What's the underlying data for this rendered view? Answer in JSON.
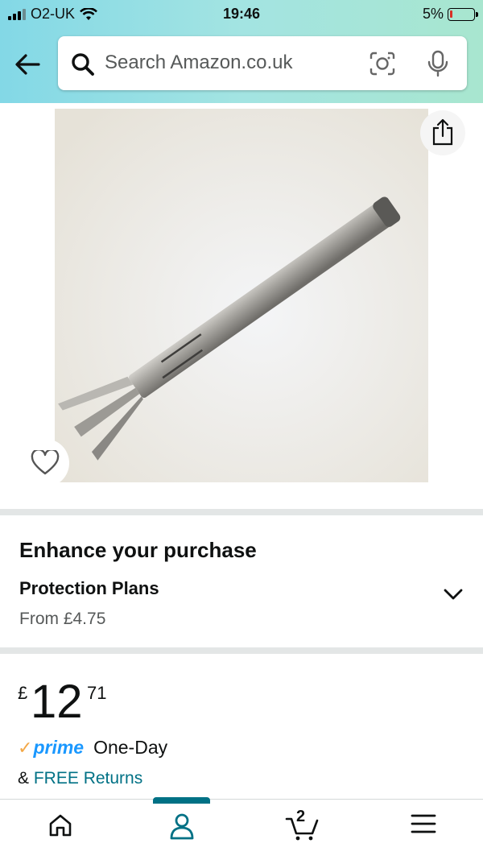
{
  "status_bar": {
    "carrier": "O2-UK",
    "time": "19:46",
    "battery": "5%"
  },
  "search": {
    "placeholder": "Search Amazon.co.uk"
  },
  "enhance": {
    "title": "Enhance your purchase",
    "protection_title": "Protection Plans",
    "protection_price": "From £4.75"
  },
  "price": {
    "currency": "£",
    "whole": "12",
    "fraction": "71"
  },
  "delivery": {
    "prime_label": "prime",
    "speed": "One-Day",
    "returns_prefix": "&",
    "returns_link": "FREE Returns"
  },
  "cart": {
    "count": "2"
  },
  "colors": {
    "header_gradient_start": "#83d8e6",
    "header_gradient_end": "#a8e6cf",
    "link": "#007185",
    "prime_blue": "#1a98ff",
    "prime_check": "#f3a847",
    "active_tab": "#007185"
  },
  "icons": [
    "back-arrow-icon",
    "search-icon",
    "camera-lens-icon",
    "microphone-icon",
    "share-icon",
    "heart-icon",
    "chevron-down-icon",
    "home-icon",
    "account-icon",
    "cart-icon",
    "menu-icon"
  ]
}
